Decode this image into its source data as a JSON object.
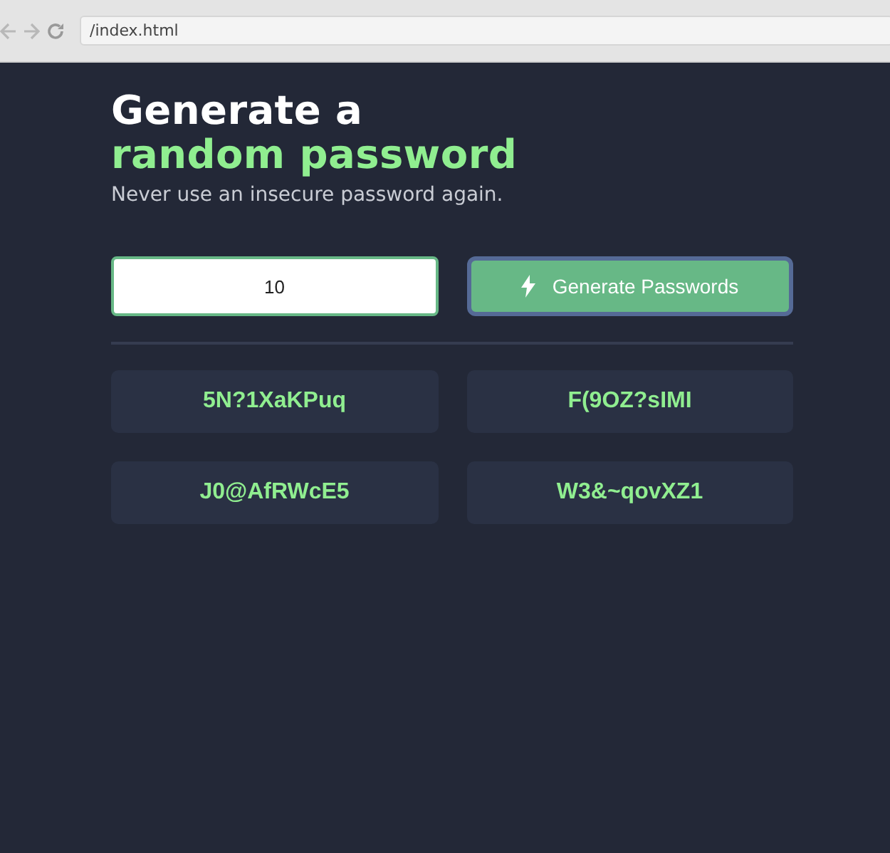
{
  "browser": {
    "address": "/index.html"
  },
  "heading": {
    "line_1": "Generate a",
    "line_2": "random password",
    "subtitle": "Never use an insecure password again."
  },
  "length_field": {
    "value": "10"
  },
  "generate_button": {
    "label": "Generate Passwords",
    "focused": true
  },
  "passwords": [
    "5N?1XaKPuq",
    "F(9OZ?sIMI",
    "J0@AfRWcE5",
    "W3&~qovXZ1"
  ]
}
